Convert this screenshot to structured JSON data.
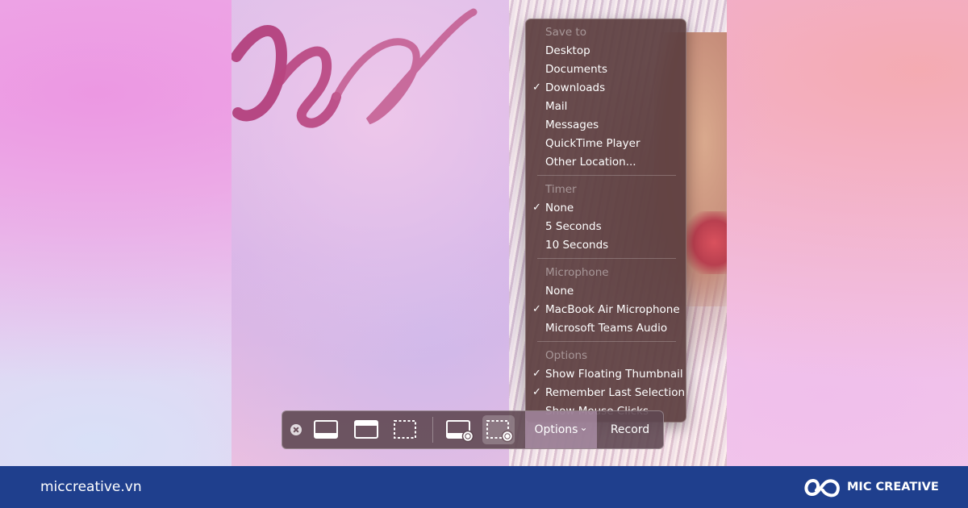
{
  "menu": {
    "sections": [
      {
        "header": "Save to",
        "items": [
          {
            "label": "Desktop",
            "checked": false
          },
          {
            "label": "Documents",
            "checked": false
          },
          {
            "label": "Downloads",
            "checked": true
          },
          {
            "label": "Mail",
            "checked": false
          },
          {
            "label": "Messages",
            "checked": false
          },
          {
            "label": "QuickTime Player",
            "checked": false
          },
          {
            "label": "Other Location...",
            "checked": false
          }
        ]
      },
      {
        "header": "Timer",
        "items": [
          {
            "label": "None",
            "checked": true
          },
          {
            "label": "5 Seconds",
            "checked": false
          },
          {
            "label": "10 Seconds",
            "checked": false
          }
        ]
      },
      {
        "header": "Microphone",
        "items": [
          {
            "label": "None",
            "checked": false
          },
          {
            "label": "MacBook Air Microphone",
            "checked": true
          },
          {
            "label": "Microsoft Teams Audio",
            "checked": false
          }
        ]
      },
      {
        "header": "Options",
        "items": [
          {
            "label": "Show Floating Thumbnail",
            "checked": true
          },
          {
            "label": "Remember Last Selection",
            "checked": true
          },
          {
            "label": "Show Mouse Clicks",
            "checked": false
          }
        ]
      }
    ],
    "check_glyph": "✓"
  },
  "toolbar": {
    "tools": [
      {
        "icon": "capture-entire-screen-icon",
        "selected": false
      },
      {
        "icon": "capture-window-icon",
        "selected": false
      },
      {
        "icon": "capture-selection-icon",
        "selected": false
      },
      {
        "icon": "record-entire-screen-icon",
        "selected": false
      },
      {
        "icon": "record-selection-icon",
        "selected": true
      }
    ],
    "options_label": "Options",
    "options_chevron": "⌄",
    "record_label": "Record"
  },
  "footer": {
    "site": "miccreative.vn",
    "brand": "MIC CREATIVE",
    "background": "#1f3f8d"
  },
  "colors": {
    "menu_background": "#5c3e40",
    "selected_tool_highlight": "#ffffff"
  }
}
